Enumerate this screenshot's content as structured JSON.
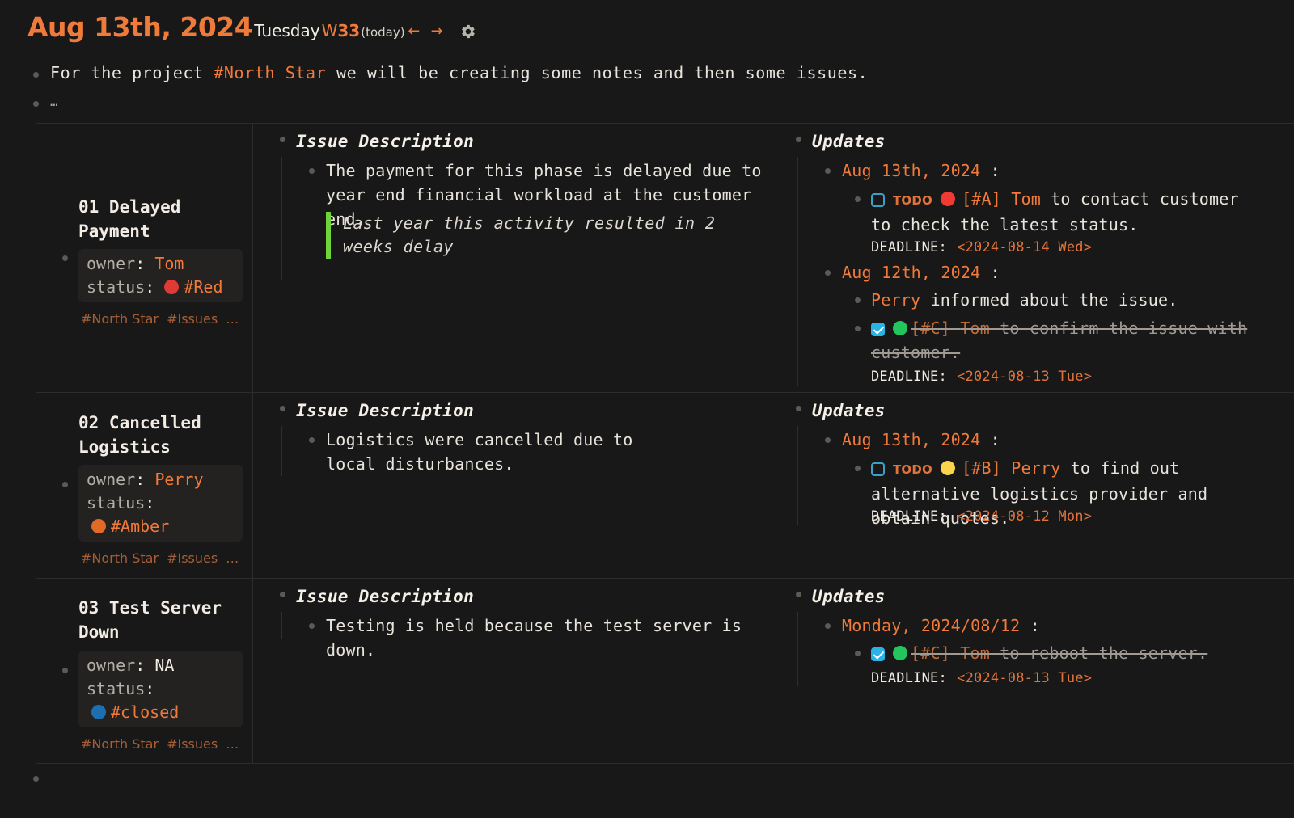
{
  "header": {
    "date": "Aug 13th, 2024",
    "weekday": "Tuesday",
    "week_prefix": "W",
    "week_num": "33",
    "today": "(today)",
    "prev": "←",
    "next": "→"
  },
  "intro": {
    "pre": "For the project ",
    "tag": "#North Star",
    "post": " we will be creating some notes and then some issues.",
    "ellipsis": "…"
  },
  "labels": {
    "issue_description": "Issue Description",
    "updates": "Updates",
    "owner": "owner",
    "status": "status",
    "deadline": "DEADLINE:",
    "todo": "TODO",
    "colon": ":"
  },
  "issues": [
    {
      "title": "01 Delayed Payment",
      "owner": "Tom",
      "status": "#Red",
      "status_color": "#e03a34",
      "tags": [
        "#North Star",
        "#Issues",
        "…"
      ],
      "description": "The payment for this phase is delayed due to year end financial workload at the customer end.",
      "quote": "Last year this activity resulted in 2 weeks delay",
      "updates": [
        {
          "date": "Aug 13th, 2024",
          "items": [
            {
              "done": false,
              "priority_color": "#f03a34",
              "priority": "[#A]",
              "who": "Tom",
              "text": " to contact customer to check the latest status.",
              "deadline": "<2024-08-14 Wed>"
            }
          ]
        },
        {
          "date": "Aug 12th, 2024",
          "items": [
            {
              "who": "Perry",
              "text": " informed about the issue."
            },
            {
              "done": true,
              "priority_color": "#22c55e",
              "priority": "[#C]",
              "who": "Tom",
              "text": " to confirm the issue with customer.",
              "deadline": "<2024-08-13 Tue>"
            }
          ]
        }
      ]
    },
    {
      "title": "02 Cancelled Logistics",
      "owner": "Perry",
      "status": "#Amber",
      "status_color": "#e06a26",
      "tags": [
        "#North Star",
        "#Issues",
        "…"
      ],
      "description": "Logistics were cancelled due to local disturbances.",
      "updates": [
        {
          "date": "Aug 13th, 2024",
          "items": [
            {
              "done": false,
              "priority_color": "#fcd34d",
              "priority": "[#B]",
              "who": "Perry",
              "text": " to find out alternative logistics provider and obtain quotes.",
              "deadline": "<2024-08-12 Mon>"
            }
          ]
        }
      ]
    },
    {
      "title": "03 Test Server Down",
      "owner": "NA",
      "status": "#closed",
      "status_color": "#1d6fb0",
      "tags": [
        "#North Star",
        "#Issues",
        "…"
      ],
      "description": "Testing is held because the test server is down.",
      "updates": [
        {
          "date": "Monday, 2024/08/12",
          "items": [
            {
              "done": true,
              "priority_color": "#22c55e",
              "priority": "[#C]",
              "who": "Tom",
              "text": " to reboot the server.",
              "deadline": "<2024-08-13 Tue>"
            }
          ]
        }
      ]
    }
  ],
  "colors": {
    "accent": "#f07a3a",
    "background": "#181818",
    "quote_bar": "#6ed43a",
    "checkbox": "#2ab3e6"
  }
}
